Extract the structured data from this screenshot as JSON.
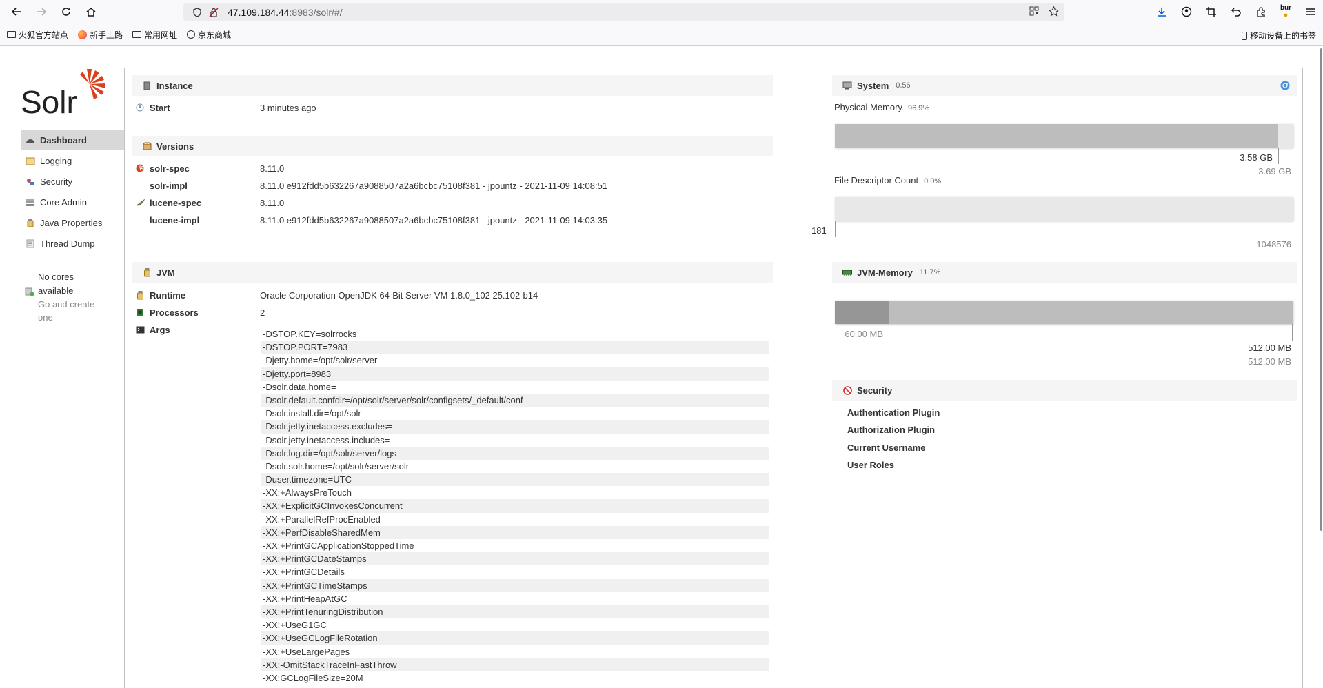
{
  "browser": {
    "url_host": "47.109.184.44",
    "url_rest": ":8983/solr/#/",
    "profile_badge": "bur",
    "bookmarks": [
      "火狐官方站点",
      "新手上路",
      "常用网址",
      "京东商城"
    ],
    "mobile_bookmarks": "移动设备上的书签"
  },
  "sidebar": {
    "items": [
      {
        "label": "Dashboard",
        "icon": "dashboard-icon"
      },
      {
        "label": "Logging",
        "icon": "logging-icon"
      },
      {
        "label": "Security",
        "icon": "security-icon"
      },
      {
        "label": "Core Admin",
        "icon": "core-admin-icon"
      },
      {
        "label": "Java Properties",
        "icon": "java-properties-icon"
      },
      {
        "label": "Thread Dump",
        "icon": "thread-dump-icon"
      }
    ],
    "no_cores_title": "No cores available",
    "no_cores_link": "Go and create one"
  },
  "instance": {
    "heading": "Instance",
    "start_label": "Start",
    "start_value": "3 minutes ago"
  },
  "versions": {
    "heading": "Versions",
    "rows": [
      {
        "k": "solr-spec",
        "v": "8.11.0"
      },
      {
        "k": "solr-impl",
        "v": "8.11.0 e912fdd5b632267a9088507a2a6bcbc75108f381 - jpountz - 2021-11-09 14:08:51"
      },
      {
        "k": "lucene-spec",
        "v": "8.11.0"
      },
      {
        "k": "lucene-impl",
        "v": "8.11.0 e912fdd5b632267a9088507a2a6bcbc75108f381 - jpountz - 2021-11-09 14:03:35"
      }
    ]
  },
  "jvm": {
    "heading": "JVM",
    "runtime_label": "Runtime",
    "runtime_value": "Oracle Corporation OpenJDK 64-Bit Server VM 1.8.0_102 25.102-b14",
    "processors_label": "Processors",
    "processors_value": "2",
    "args_label": "Args",
    "args": [
      "-DSTOP.KEY=solrrocks",
      "-DSTOP.PORT=7983",
      "-Djetty.home=/opt/solr/server",
      "-Djetty.port=8983",
      "-Dsolr.data.home=",
      "-Dsolr.default.confdir=/opt/solr/server/solr/configsets/_default/conf",
      "-Dsolr.install.dir=/opt/solr",
      "-Dsolr.jetty.inetaccess.excludes=",
      "-Dsolr.jetty.inetaccess.includes=",
      "-Dsolr.log.dir=/opt/solr/server/logs",
      "-Dsolr.solr.home=/opt/solr/server/solr",
      "-Duser.timezone=UTC",
      "-XX:+AlwaysPreTouch",
      "-XX:+ExplicitGCInvokesConcurrent",
      "-XX:+ParallelRefProcEnabled",
      "-XX:+PerfDisableSharedMem",
      "-XX:+PrintGCApplicationStoppedTime",
      "-XX:+PrintGCDateStamps",
      "-XX:+PrintGCDetails",
      "-XX:+PrintGCTimeStamps",
      "-XX:+PrintHeapAtGC",
      "-XX:+PrintTenuringDistribution",
      "-XX:+UseG1GC",
      "-XX:+UseGCLogFileRotation",
      "-XX:+UseLargePages",
      "-XX:-OmitStackTraceInFastThrow",
      "-XX:GCLogFileSize=20M"
    ]
  },
  "system": {
    "heading": "System",
    "load": "0.56",
    "physical_memory_label": "Physical Memory",
    "physical_memory_pct": "96.9%",
    "physical_memory_fraction": 0.969,
    "physical_used": "3.58 GB",
    "physical_total": "3.69 GB",
    "fd_label": "File Descriptor Count",
    "fd_pct": "0.0%",
    "fd_fraction": 0.0,
    "fd_used": "181",
    "fd_max": "1048576"
  },
  "jvm_memory": {
    "heading": "JVM-Memory",
    "pct": "11.7%",
    "used_fraction": 0.117,
    "committed_fraction": 1.0,
    "used": "60.00 MB",
    "committed": "512.00 MB",
    "max": "512.00 MB"
  },
  "security": {
    "heading": "Security",
    "items": [
      "Authentication Plugin",
      "Authorization Plugin",
      "Current Username",
      "User Roles"
    ]
  }
}
